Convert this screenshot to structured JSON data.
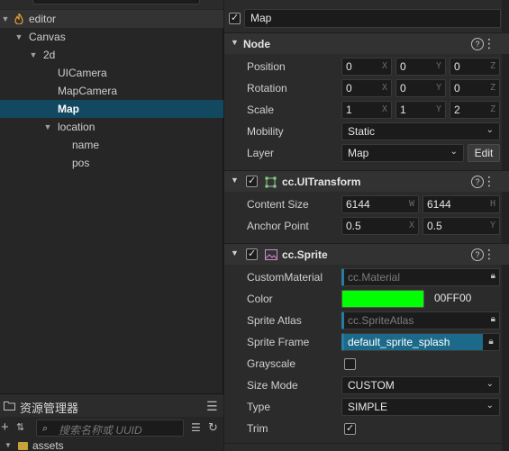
{
  "hierarchy": {
    "items": [
      {
        "label": "editor"
      },
      {
        "label": "Canvas"
      },
      {
        "label": "2d"
      },
      {
        "label": "UICamera"
      },
      {
        "label": "MapCamera"
      },
      {
        "label": "Map"
      },
      {
        "label": "location"
      },
      {
        "label": "name"
      },
      {
        "label": "pos"
      }
    ]
  },
  "assets": {
    "title": "资源管理器",
    "search_placeholder": "搜索名称或 UUID",
    "root_label": "assets"
  },
  "inspector": {
    "node_name": "Map",
    "node_section": {
      "title": "Node",
      "position": {
        "label": "Position",
        "x": "0",
        "y": "0",
        "z": "0"
      },
      "rotation": {
        "label": "Rotation",
        "x": "0",
        "y": "0",
        "z": "0"
      },
      "scale": {
        "label": "Scale",
        "x": "1",
        "y": "1",
        "z": "2"
      },
      "mobility": {
        "label": "Mobility",
        "value": "Static"
      },
      "layer": {
        "label": "Layer",
        "value": "Map",
        "edit_label": "Edit"
      },
      "axis_x": "X",
      "axis_y": "Y",
      "axis_z": "Z"
    },
    "uitransform": {
      "title": "cc.UITransform",
      "content_size": {
        "label": "Content Size",
        "w": "6144",
        "h": "6144",
        "w_axis": "W",
        "h_axis": "H"
      },
      "anchor_point": {
        "label": "Anchor Point",
        "x": "0.5",
        "y": "0.5",
        "x_axis": "X",
        "y_axis": "Y"
      }
    },
    "sprite": {
      "title": "cc.Sprite",
      "custom_material": {
        "label": "CustomMaterial",
        "value": "cc.Material"
      },
      "color": {
        "label": "Color",
        "hex": "00FF00",
        "swatch": "#00ff00"
      },
      "sprite_atlas": {
        "label": "Sprite Atlas",
        "value": "cc.SpriteAtlas"
      },
      "sprite_frame": {
        "label": "Sprite Frame",
        "value": "default_sprite_splash"
      },
      "grayscale": {
        "label": "Grayscale",
        "checked": false
      },
      "size_mode": {
        "label": "Size Mode",
        "value": "CUSTOM"
      },
      "type": {
        "label": "Type",
        "value": "SIMPLE"
      },
      "trim": {
        "label": "Trim",
        "checked": true
      }
    }
  },
  "colors": {
    "selection": "#124860",
    "accent": "#2a7ba4",
    "swatch": "#00ff00"
  }
}
